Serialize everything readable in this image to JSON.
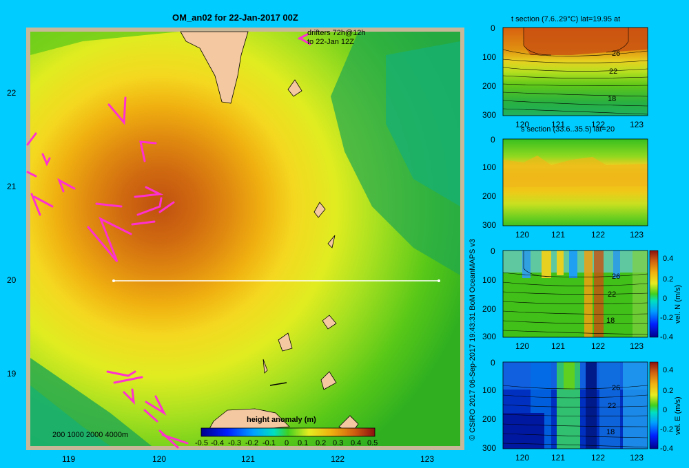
{
  "chart_data": [
    {
      "type": "heatmap",
      "title": "OM_an02 for 22-Jan-2017 00Z",
      "colorbar_label": "height anomaly (m)",
      "colorbar_ticks": [
        "-0.5",
        "-0.4",
        "-0.3",
        "-0.2",
        "-0.1",
        "0",
        "0.1",
        "0.2",
        "0.3",
        "0.4",
        "0.5"
      ],
      "x_ticks": [
        "119",
        "120",
        "121",
        "122",
        "123"
      ],
      "y_ticks": [
        "22",
        "21",
        "20",
        "19"
      ],
      "xlim": [
        118.5,
        123.5
      ],
      "ylim": [
        18.3,
        22.7
      ],
      "drifters_label": "drifters 72h@12h",
      "drifters_label2": "to 22-Jan 12Z",
      "depth_legend": "200  1000  2000  4000m",
      "section_line": {
        "lon": [
          119.5,
          123.2
        ],
        "lat": [
          20.0,
          20.0
        ]
      }
    },
    {
      "type": "heatmap",
      "title": "t section (7.6..29°C) lat=19.95 at",
      "x_ticks": [
        "120",
        "121",
        "122",
        "123"
      ],
      "y_ticks": [
        "0",
        "100",
        "200",
        "300"
      ],
      "contour_labels": [
        "26",
        "22",
        "18"
      ]
    },
    {
      "type": "heatmap",
      "title": "s section (33.6..35.5) lat=20",
      "x_ticks": [
        "120",
        "121",
        "122",
        "123"
      ],
      "y_ticks": [
        "0",
        "100",
        "200",
        "300"
      ]
    },
    {
      "type": "heatmap",
      "title": "",
      "x_ticks": [
        "120",
        "121",
        "122",
        "123"
      ],
      "y_ticks": [
        "0",
        "100",
        "200",
        "300"
      ],
      "contour_labels": [
        "26",
        "22",
        "18"
      ],
      "colorbar_label": "vel. N (m/s)",
      "colorbar_ticks": [
        "0.4",
        "0.2",
        "0",
        "-0.2",
        "-0.4"
      ]
    },
    {
      "type": "heatmap",
      "title": "",
      "x_ticks": [
        "120",
        "121",
        "122",
        "123"
      ],
      "y_ticks": [
        "0",
        "100",
        "200",
        "300"
      ],
      "contour_labels": [
        "26",
        "22",
        "18"
      ],
      "colorbar_label": "vel. E (m/s)",
      "colorbar_ticks": [
        "0.4",
        "0.2",
        "0",
        "-0.2",
        "-0.4"
      ]
    }
  ],
  "credit": "© CSIRO 2017   06-Sep-2017 19:43:31 BoM OceanMAPS v3"
}
